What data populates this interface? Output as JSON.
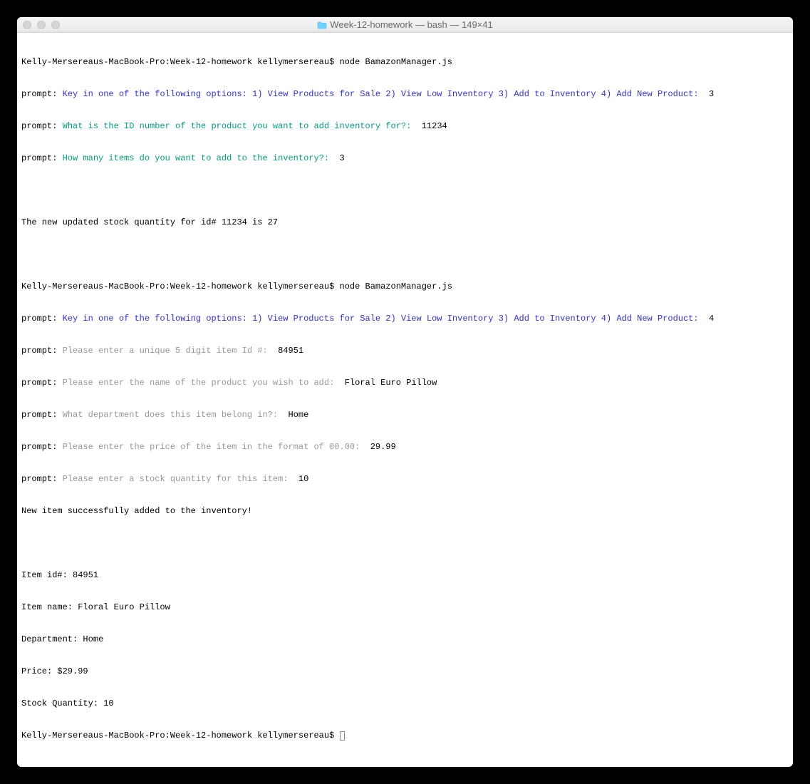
{
  "window": {
    "title": "Week-12-homework — bash — 149×41"
  },
  "session1": {
    "shell_prefix": "Kelly-Mersereaus-MacBook-Pro:Week-12-homework kellymersereau$ ",
    "command": "node BamazonManager.js",
    "prompt_label": "prompt:",
    "q1": "Key in one of the following options: 1) View Products for Sale 2) View Low Inventory 3) Add to Inventory 4) Add New Product:",
    "a1": "3",
    "q2": "What is the ID number of the product you want to add inventory for?:",
    "a2": "11234",
    "q3": "How many items do you want to add to the inventory?:",
    "a3": "3",
    "result": "The new updated stock quantity for id# 11234 is 27"
  },
  "session2": {
    "shell_prefix": "Kelly-Mersereaus-MacBook-Pro:Week-12-homework kellymersereau$ ",
    "command": "node BamazonManager.js",
    "prompt_label": "prompt:",
    "q1": "Key in one of the following options: 1) View Products for Sale 2) View Low Inventory 3) Add to Inventory 4) Add New Product:",
    "a1": "4",
    "q2": "Please enter a unique 5 digit item Id #:",
    "a2": "84951",
    "q3": "Please enter the name of the product you wish to add:",
    "a3": "Floral Euro Pillow",
    "q4": "What department does this item belong in?:",
    "a4": "Home",
    "q5": "Please enter the price of the item in the format of 00.00:",
    "a5": "29.99",
    "q6": "Please enter a stock quantity for this item:",
    "a6": "10",
    "success": "New item successfully added to the inventory!",
    "summary": {
      "l1": "Item id#: 84951",
      "l2": "Item name: Floral Euro Pillow",
      "l3": "Department: Home",
      "l4": "Price: $29.99",
      "l5": "Stock Quantity: 10"
    }
  },
  "final_prompt": "Kelly-Mersereaus-MacBook-Pro:Week-12-homework kellymersereau$ "
}
